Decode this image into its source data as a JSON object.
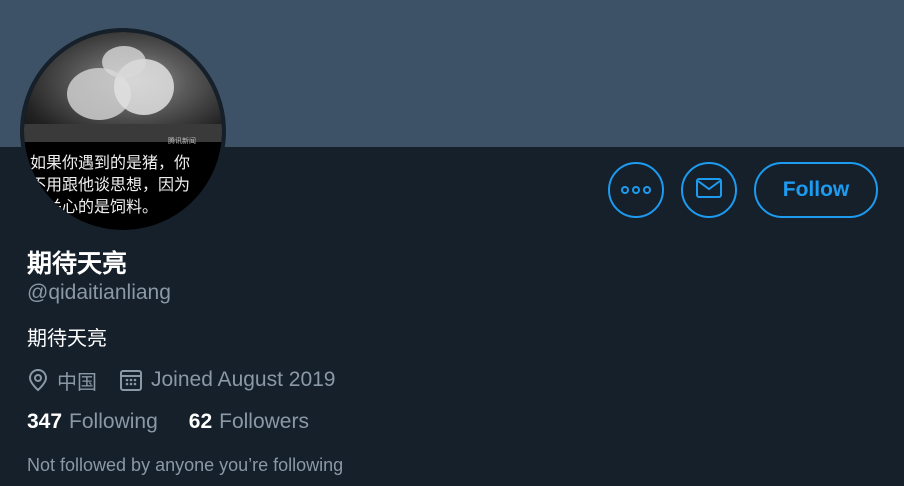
{
  "banner": {
    "color": "#3d5266"
  },
  "avatar": {
    "caption": "如果你遇到的是猪，你\n不用跟他谈思想，因为\n他关心的是饲料。",
    "watermark": "腾讯新闻"
  },
  "actions": {
    "more_icon": "more-horizontal-icon",
    "message_icon": "envelope-icon",
    "follow_label": "Follow"
  },
  "profile": {
    "display_name": "期待天亮",
    "handle": "@qidaitianliang",
    "bio": "期待天亮",
    "location": "中国",
    "joined": "Joined August 2019"
  },
  "stats": {
    "following_count": "347",
    "following_label": "Following",
    "followers_count": "62",
    "followers_label": "Followers"
  },
  "social_context": "Not followed by anyone you’re following",
  "colors": {
    "accent": "#1d9bf0",
    "background": "#15202b",
    "secondary_text": "#8b98a5"
  }
}
